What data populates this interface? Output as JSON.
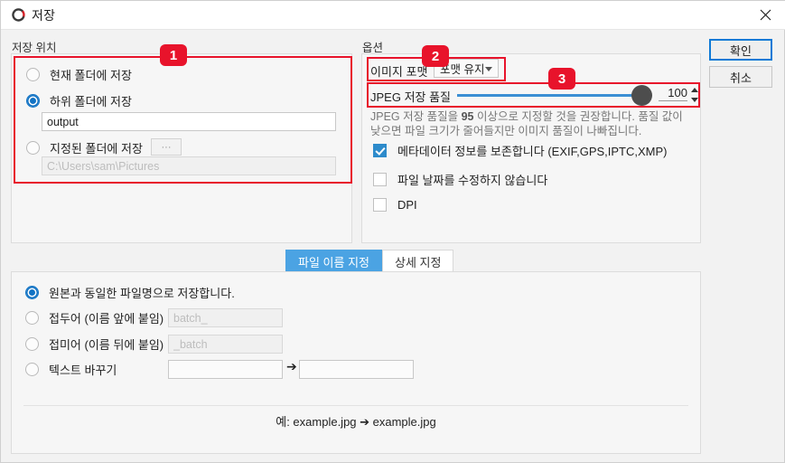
{
  "window": {
    "title": "저장",
    "icon": "app-logo-icon",
    "close_label": "✕"
  },
  "buttons": {
    "ok": "확인",
    "cancel": "취소"
  },
  "save_location": {
    "group_label": "저장 위치",
    "badge": "1",
    "options": [
      {
        "label": "현재 폴더에 저장",
        "selected": false
      },
      {
        "label": "하위 폴더에 저장",
        "selected": true
      },
      {
        "label": "지정된 폴더에 저장",
        "selected": false
      }
    ],
    "subfolder_value": "output",
    "browse_label": "···",
    "path_placeholder": "C:\\Users\\sam\\Pictures"
  },
  "options": {
    "group_label": "옵션",
    "format_badge": "2",
    "quality_badge": "3",
    "format_label": "이미지 포맷",
    "format_value": "포맷 유지",
    "quality_label": "JPEG 저장 품질",
    "quality_value": "100",
    "quality_percent": 100,
    "hint_before": "JPEG 저장 품질을 ",
    "hint_bold": "95",
    "hint_after": " 이상으로 지정할 것을 권장합니다. 품질 값이 낮으면 파일 크기가 줄어들지만 이미지 품질이 나빠집니다.",
    "checkboxes": [
      {
        "label": "메타데이터 정보를 보존합니다 (EXIF,GPS,IPTC,XMP)",
        "checked": true
      },
      {
        "label": "파일 날짜를 수정하지 않습니다",
        "checked": false
      },
      {
        "label": "DPI",
        "checked": false
      }
    ]
  },
  "naming": {
    "tabs": [
      {
        "label": "파일 이름 지정",
        "active": true
      },
      {
        "label": "상세 지정",
        "active": false
      }
    ],
    "options": [
      {
        "label": "원본과 동일한 파일명으로 저장합니다.",
        "selected": true
      },
      {
        "label": "접두어 (이름 앞에 붙임)",
        "selected": false,
        "placeholder": "batch_"
      },
      {
        "label": "접미어 (이름 뒤에 붙임)",
        "selected": false,
        "placeholder": "_batch"
      },
      {
        "label": "텍스트 바꾸기",
        "selected": false,
        "find_value": "",
        "replace_value": ""
      }
    ],
    "replace_arrow": "➔",
    "example": "예: example.jpg ➔ example.jpg"
  },
  "colors": {
    "accent_blue": "#1273c4",
    "tab_blue": "#4ba3e3",
    "badge_red": "#e8132b",
    "slider_blue": "#3b8fd4"
  }
}
